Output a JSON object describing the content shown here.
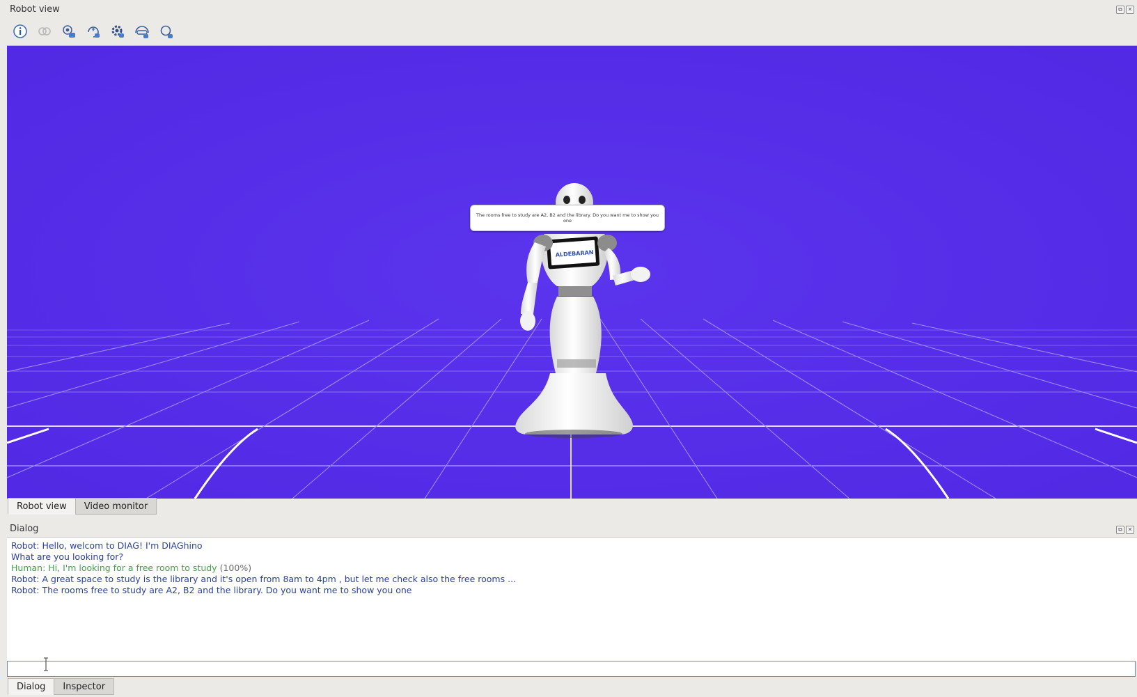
{
  "robot_view_panel": {
    "title": "Robot view",
    "toolbar": [
      {
        "icon": "info-icon"
      },
      {
        "icon": "link-icon"
      },
      {
        "icon": "camera-settings-icon"
      },
      {
        "icon": "reset-view-icon"
      },
      {
        "icon": "settings-icon"
      },
      {
        "icon": "view-mode-icon"
      },
      {
        "icon": "zoom-icon"
      }
    ],
    "speech_bubble": "The rooms free to study are A2, B2 and the library. Do you want me to show you one",
    "tablet_logo": "ALDEBARAN",
    "tabs": [
      {
        "label": "Robot view",
        "active": true
      },
      {
        "label": "Video monitor",
        "active": false
      }
    ]
  },
  "dialog_panel": {
    "title": "Dialog",
    "lines": [
      {
        "speaker": "robot",
        "text": "Robot: Hello, welcom to DIAG! I'm DIAGhino"
      },
      {
        "speaker": "robot",
        "text": "What are you looking for?"
      },
      {
        "speaker": "human",
        "text": "Human: Hi, I'm looking for a free room to study",
        "confidence": "(100%)"
      },
      {
        "speaker": "robot",
        "text": "Robot: A great space to study is the library and it's open from 8am to 4pm , but let me check also the free rooms ..."
      },
      {
        "speaker": "robot",
        "text": "Robot: The rooms free to study are A2, B2 and the library. Do you want me to show you one"
      }
    ],
    "input_value": "",
    "tabs": [
      {
        "label": "Dialog",
        "active": true
      },
      {
        "label": "Inspector",
        "active": false
      }
    ]
  },
  "colors": {
    "viewport_background": "#5530e8",
    "robot_text": "#2a3fa5",
    "human_text": "#3fa34a"
  }
}
